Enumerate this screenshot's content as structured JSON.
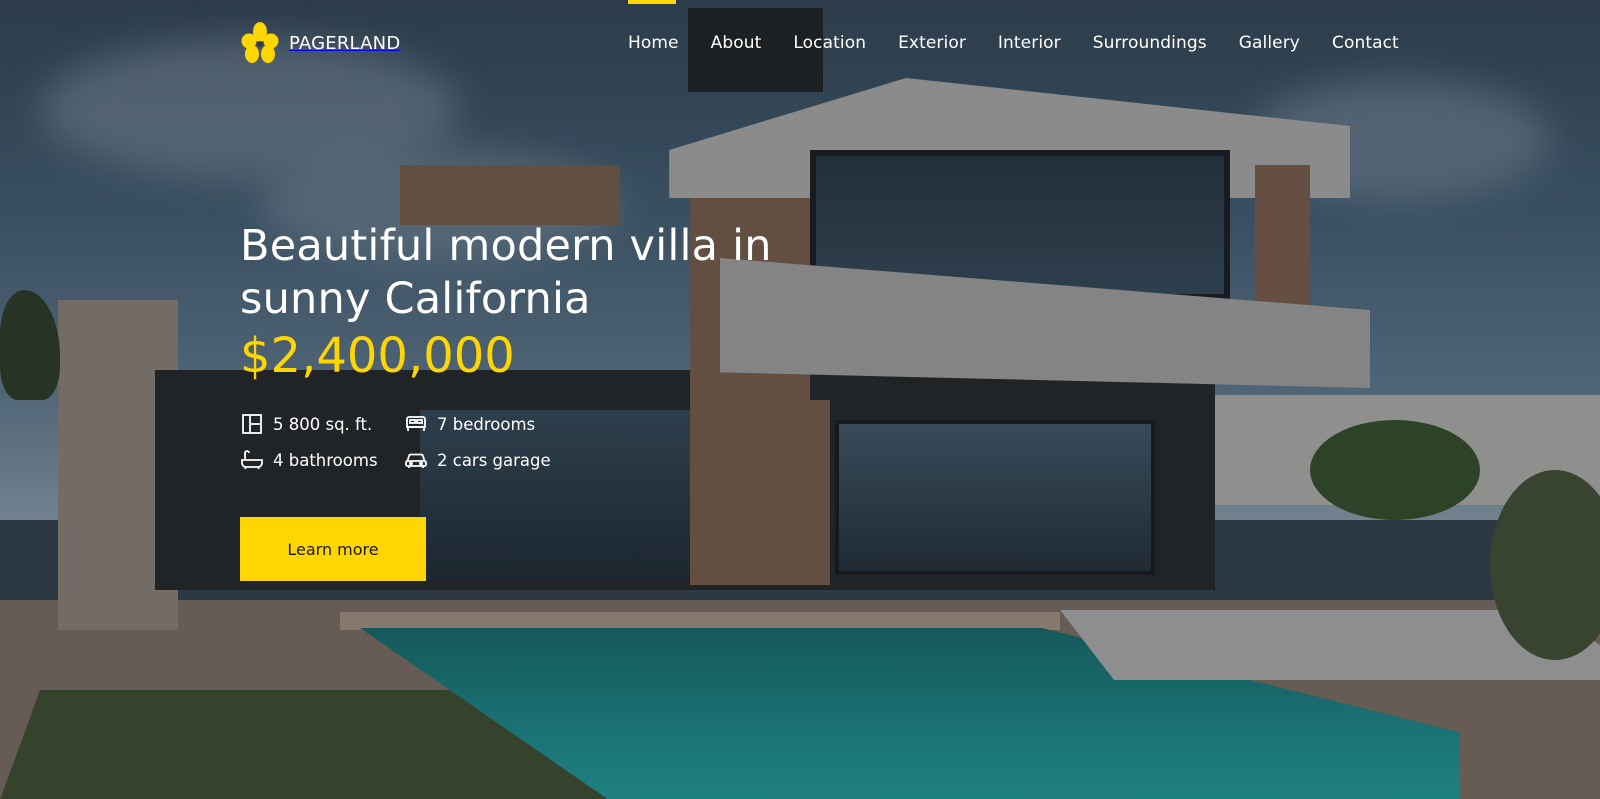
{
  "brand": {
    "name": "PAGERLAND",
    "icon": "flower-logo-icon",
    "accent_color": "#FFD600"
  },
  "nav": {
    "items": [
      "Home",
      "About",
      "Location",
      "Exterior",
      "Interior",
      "Surroundings",
      "Gallery",
      "Contact"
    ],
    "active": "Home"
  },
  "hero": {
    "title": "Beautiful modern villa in sunny California",
    "price": "$2,400,000",
    "features": [
      {
        "icon": "floorplan-icon",
        "label": "5 800 sq. ft."
      },
      {
        "icon": "bed-icon",
        "label": "7 bedrooms"
      },
      {
        "icon": "bathtub-icon",
        "label": "4 bathrooms"
      },
      {
        "icon": "car-icon",
        "label": "2 cars garage"
      }
    ],
    "cta_label": "Learn more"
  }
}
